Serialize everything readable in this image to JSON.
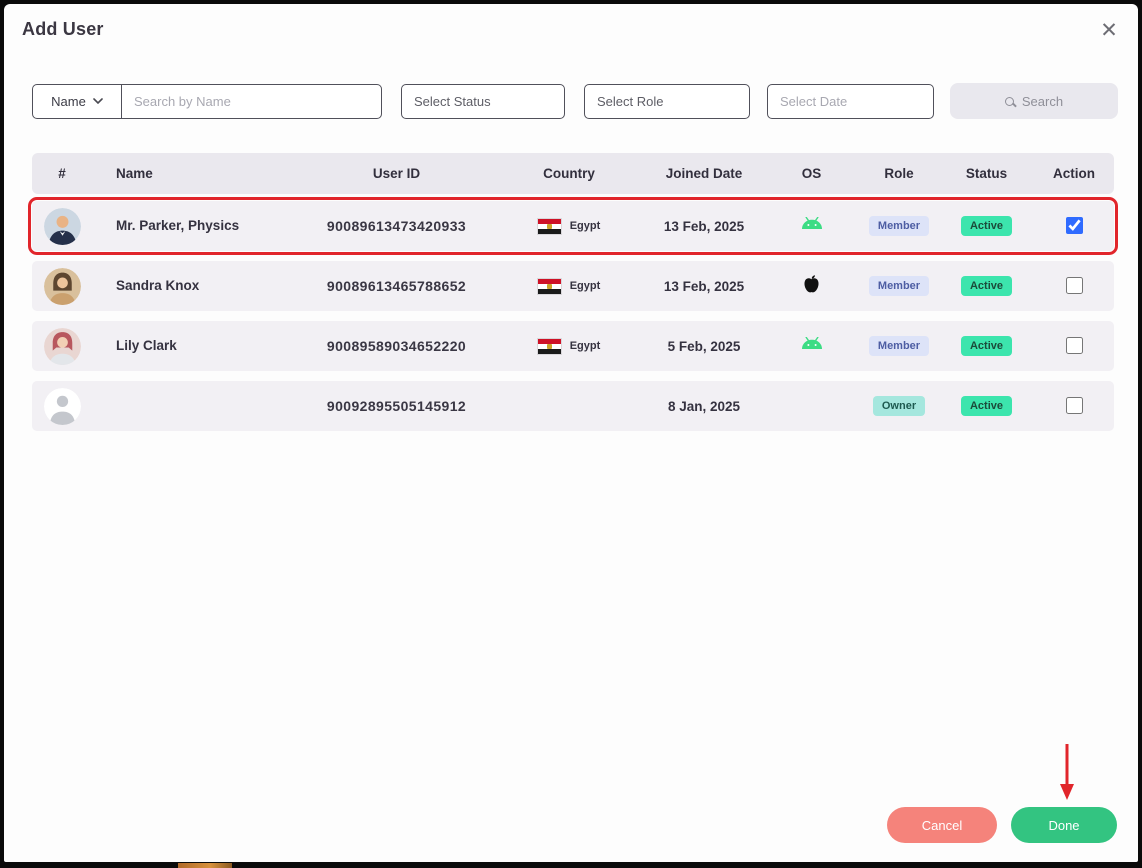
{
  "modal": {
    "title": "Add User",
    "close_glyph": "✕"
  },
  "filters": {
    "name_dropdown_label": "Name",
    "search_placeholder": "Search by Name",
    "status_placeholder": "Select Status",
    "role_placeholder": "Select Role",
    "date_placeholder": "Select Date",
    "search_button_label": "Search"
  },
  "table": {
    "headers": [
      "#",
      "Name",
      "User ID",
      "Country",
      "Joined Date",
      "OS",
      "Role",
      "Status",
      "Action"
    ],
    "rows": [
      {
        "name": "Mr. Parker, Physics",
        "user_id": "90089613473420933",
        "country": "Egypt",
        "joined": "13 Feb, 2025",
        "os": "android",
        "role": "Member",
        "status": "Active",
        "checked": true
      },
      {
        "name": "Sandra Knox",
        "user_id": "90089613465788652",
        "country": "Egypt",
        "joined": "13 Feb, 2025",
        "os": "apple",
        "role": "Member",
        "status": "Active",
        "checked": false
      },
      {
        "name": "Lily Clark",
        "user_id": "90089589034652220",
        "country": "Egypt",
        "joined": "5 Feb, 2025",
        "os": "android",
        "role": "Member",
        "status": "Active",
        "checked": false
      },
      {
        "name": "",
        "user_id": "90092895505145912",
        "country": "",
        "joined": "8 Jan, 2025",
        "os": "",
        "role": "Owner",
        "status": "Active",
        "checked": false
      }
    ]
  },
  "footer": {
    "cancel_label": "Cancel",
    "done_label": "Done"
  },
  "annotation": {
    "highlighted_row_index": 0,
    "arrow_points_to": "done-button",
    "color": "#e1252b"
  },
  "colors": {
    "active_badge": "#3ce5ad",
    "member_badge_bg": "#dde3f8",
    "member_badge_text": "#4d5da3",
    "owner_badge_bg": "#a5e7de",
    "cancel_button": "#f5837b",
    "done_button": "#33c481",
    "checkbox_checked": "#2f6bff",
    "android_green": "#3ddc84",
    "annotation_red": "#e1252b"
  }
}
